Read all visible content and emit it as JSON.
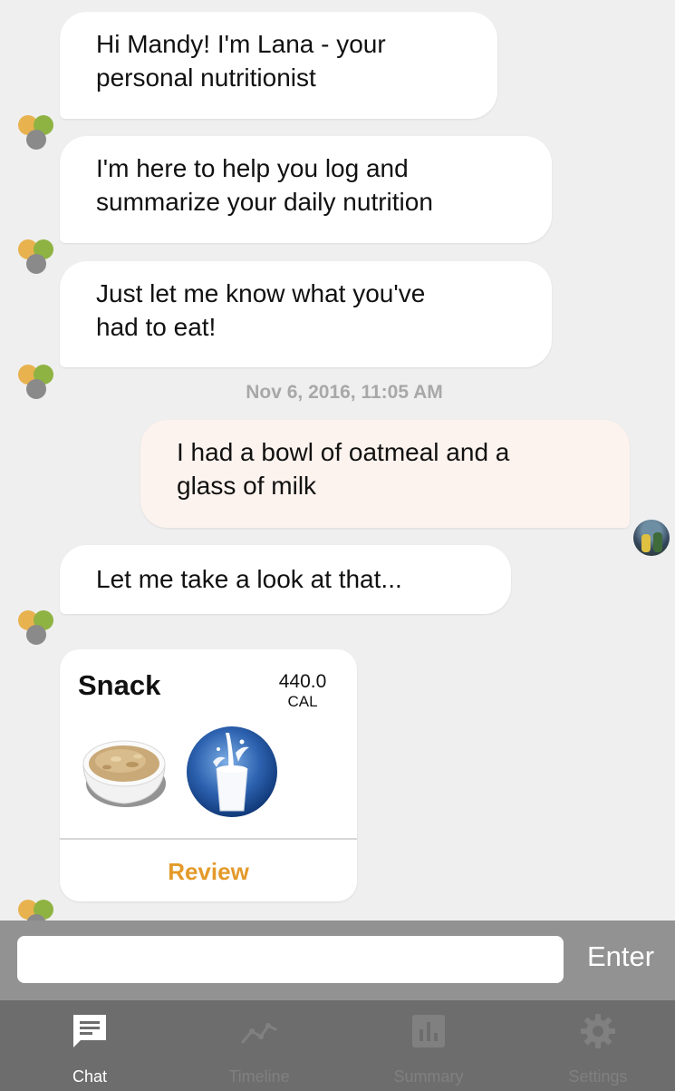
{
  "messages": [
    {
      "from": "bot",
      "text_line1": "Hi Mandy! I'm Lana - your",
      "text_line2": "personal nutritionist"
    },
    {
      "from": "bot",
      "text_line1": "I'm here to help you log and",
      "text_line2": "summarize your daily nutrition"
    },
    {
      "from": "bot",
      "text_line1": "Just let me know what you've",
      "text_line2": "had to eat!"
    },
    {
      "from": "user",
      "text_line1": "I had a bowl of oatmeal and a",
      "text_line2": "glass of milk"
    },
    {
      "from": "bot",
      "text_line1": "Let me take a look at that..."
    }
  ],
  "timestamp": "Nov 6, 2016, 11:05 AM",
  "meal_card": {
    "title": "Snack",
    "calories": "440.0",
    "calories_unit": "CAL",
    "items": [
      "oatmeal",
      "milk"
    ],
    "review_label": "Review"
  },
  "input": {
    "value": "",
    "placeholder": "",
    "enter_label": "Enter"
  },
  "tabs": [
    {
      "label": "Chat",
      "icon": "chat-icon",
      "active": true
    },
    {
      "label": "Timeline",
      "icon": "timeline-icon",
      "active": false
    },
    {
      "label": "Summary",
      "icon": "summary-icon",
      "active": false
    },
    {
      "label": "Settings",
      "icon": "settings-icon",
      "active": false
    }
  ],
  "colors": {
    "background": "#efefef",
    "bot_bubble": "#ffffff",
    "user_bubble": "#fdf3ee",
    "accent": "#e49a2a",
    "tab_active": "#ffffff",
    "tab_inactive": "#808080",
    "tabbar_bg": "#6d6d6d",
    "input_bar_bg": "#929292"
  }
}
